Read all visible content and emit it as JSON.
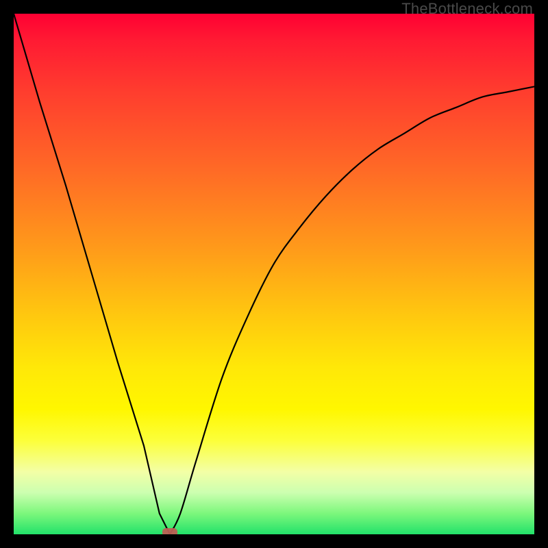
{
  "watermark": "TheBottleneck.com",
  "chart_data": {
    "type": "line",
    "title": "",
    "xlabel": "",
    "ylabel": "",
    "xlim": [
      0,
      100
    ],
    "ylim": [
      0,
      100
    ],
    "background": "red-yellow-green vertical gradient (red top, green bottom)",
    "curve_description": "V-shaped bottleneck curve: steep linear descent from top-left to a minimum near x≈30, then asymptotic rise toward upper-right",
    "minimum_x": 30,
    "minimum_y": 0,
    "marker": {
      "x": 30,
      "y": 0,
      "color": "#c06055",
      "shape": "rounded-rect"
    },
    "series": [
      {
        "name": "bottleneck-curve",
        "points": [
          {
            "x": 0,
            "y": 100
          },
          {
            "x": 5,
            "y": 83
          },
          {
            "x": 10,
            "y": 67
          },
          {
            "x": 15,
            "y": 50
          },
          {
            "x": 20,
            "y": 33
          },
          {
            "x": 25,
            "y": 17
          },
          {
            "x": 28,
            "y": 4
          },
          {
            "x": 30,
            "y": 0
          },
          {
            "x": 32,
            "y": 4
          },
          {
            "x": 35,
            "y": 14
          },
          {
            "x": 40,
            "y": 30
          },
          {
            "x": 45,
            "y": 42
          },
          {
            "x": 50,
            "y": 52
          },
          {
            "x": 55,
            "y": 59
          },
          {
            "x": 60,
            "y": 65
          },
          {
            "x": 65,
            "y": 70
          },
          {
            "x": 70,
            "y": 74
          },
          {
            "x": 75,
            "y": 77
          },
          {
            "x": 80,
            "y": 80
          },
          {
            "x": 85,
            "y": 82
          },
          {
            "x": 90,
            "y": 84
          },
          {
            "x": 95,
            "y": 85
          },
          {
            "x": 100,
            "y": 86
          }
        ]
      }
    ]
  }
}
